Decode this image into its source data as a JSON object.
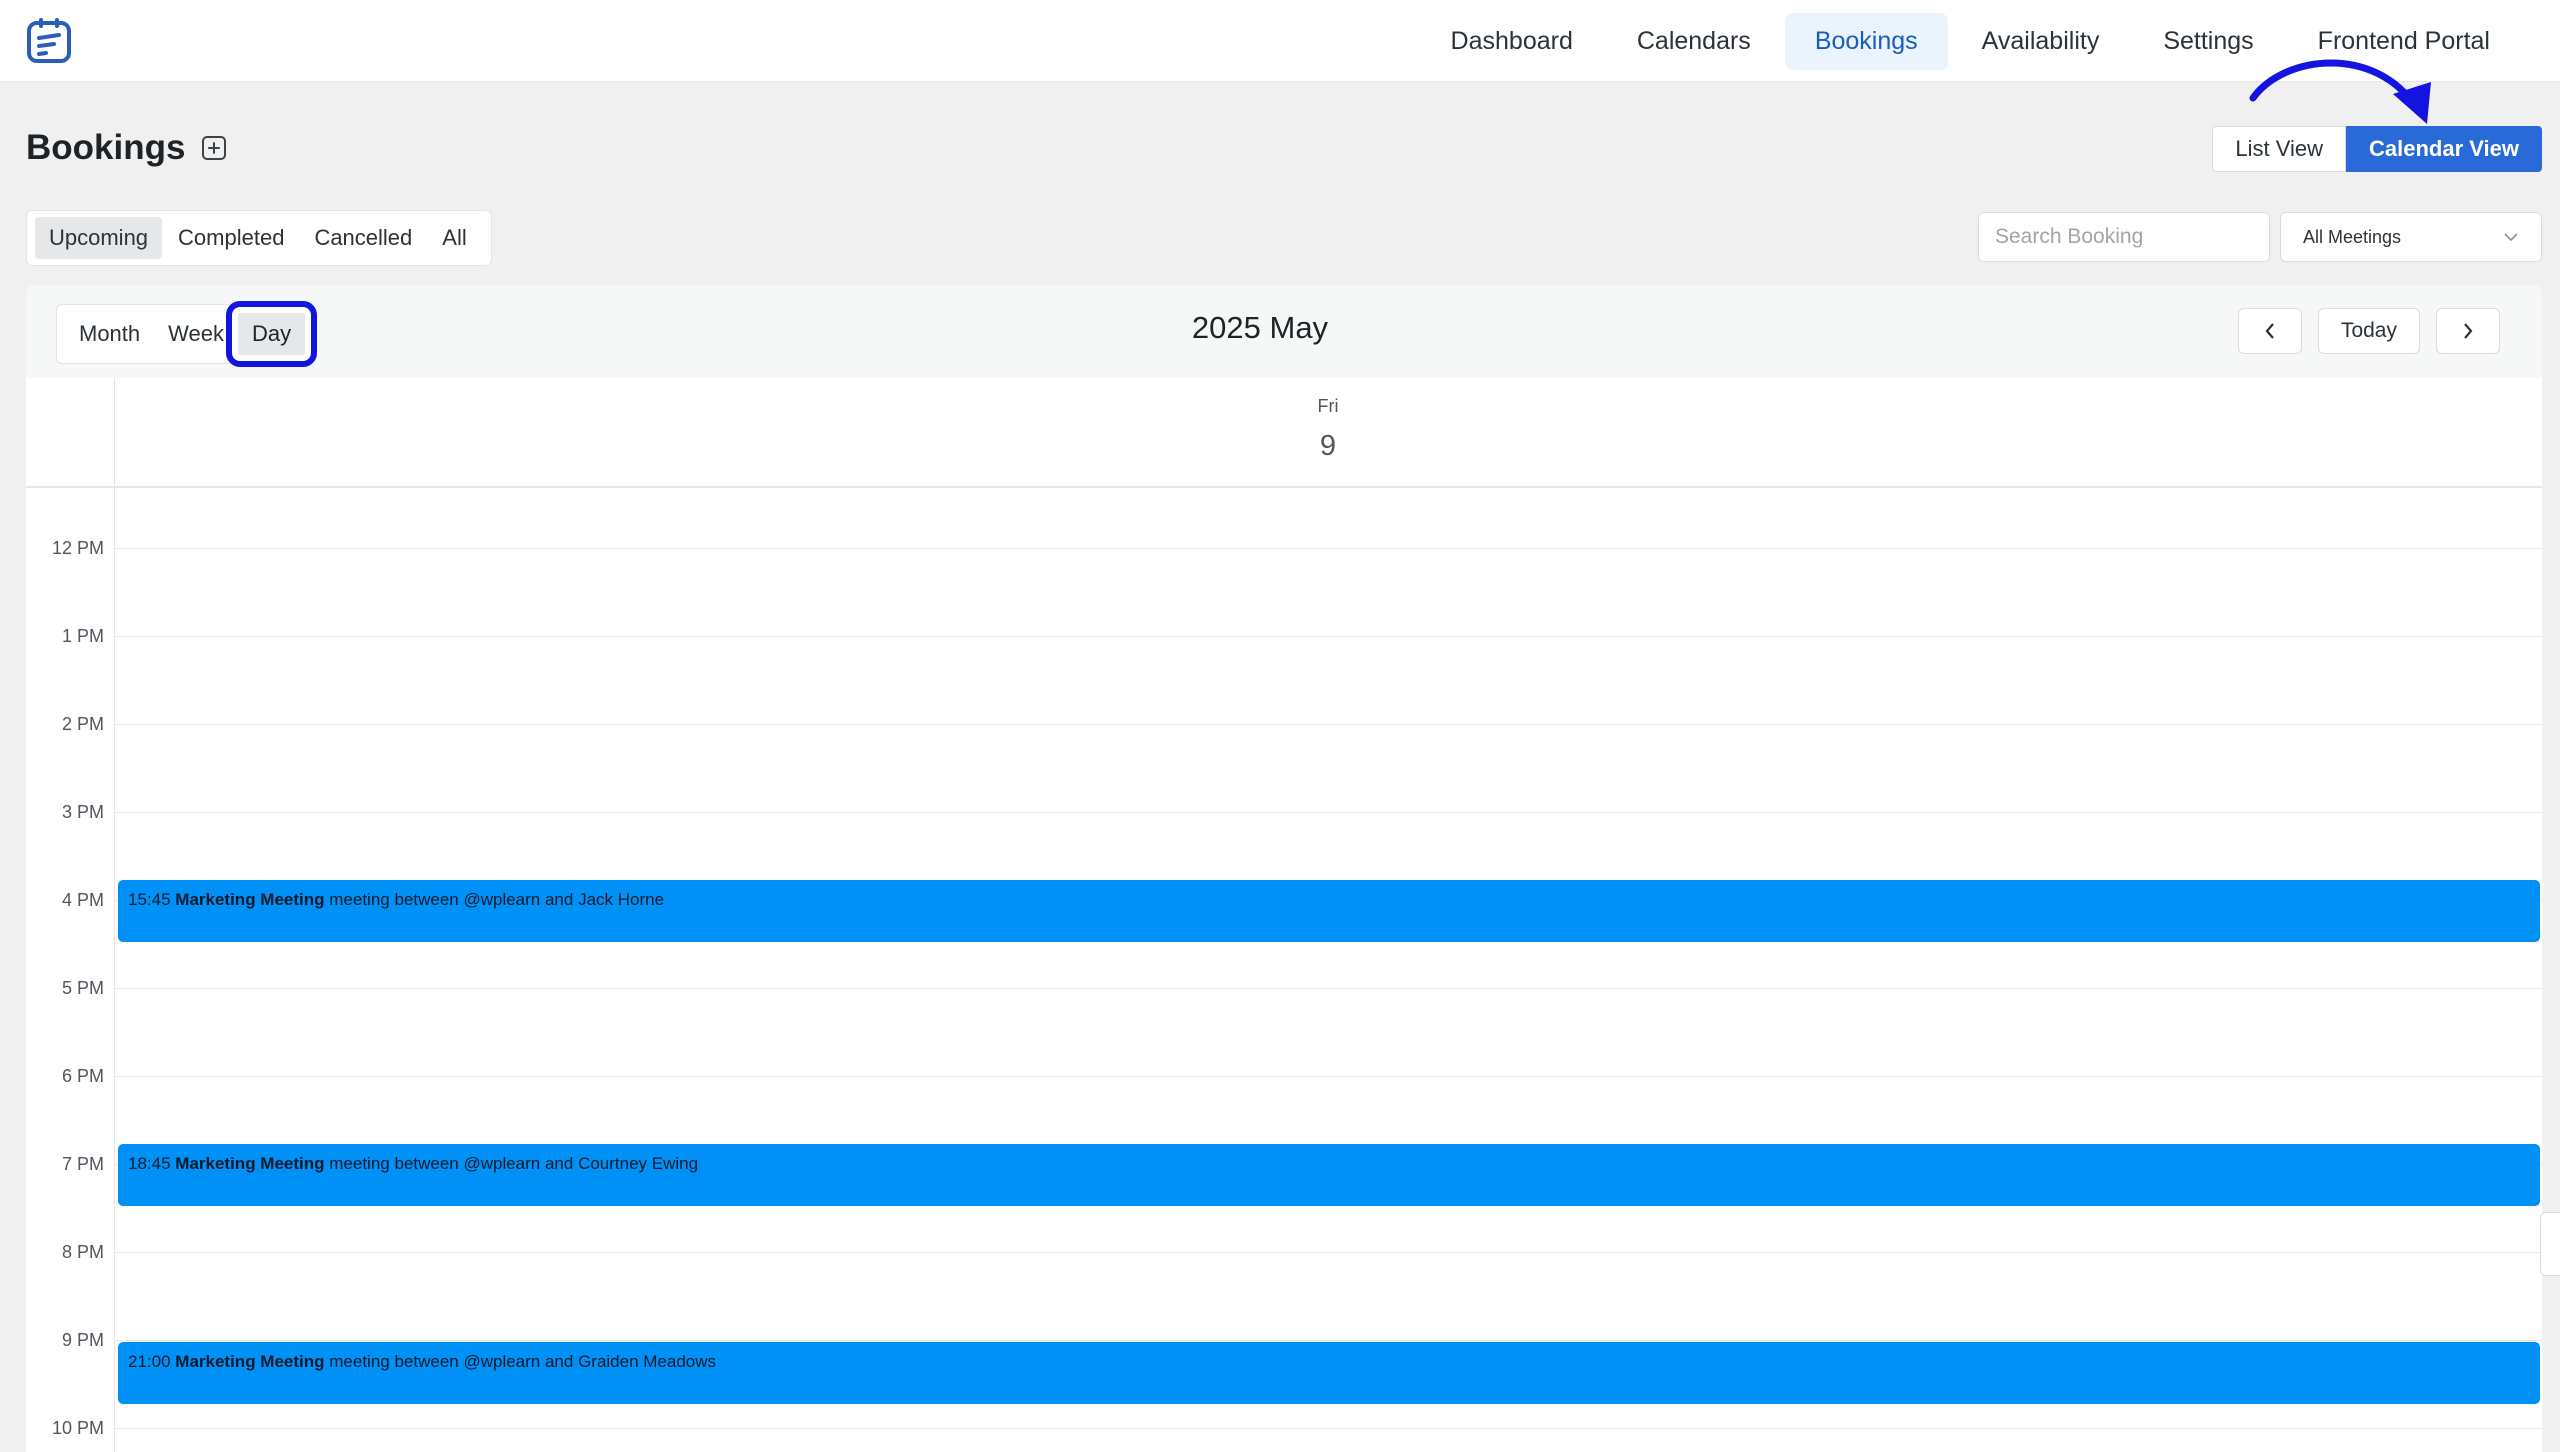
{
  "nav": {
    "items": [
      {
        "label": "Dashboard",
        "active": false
      },
      {
        "label": "Calendars",
        "active": false
      },
      {
        "label": "Bookings",
        "active": true
      },
      {
        "label": "Availability",
        "active": false
      },
      {
        "label": "Settings",
        "active": false
      },
      {
        "label": "Frontend Portal",
        "active": false
      }
    ]
  },
  "page": {
    "title": "Bookings",
    "add_icon": "plus-square-icon"
  },
  "view_toggle": {
    "list_label": "List View",
    "calendar_label": "Calendar View",
    "selected": "Calendar View"
  },
  "status_tabs": {
    "items": [
      "Upcoming",
      "Completed",
      "Cancelled",
      "All"
    ],
    "selected": "Upcoming"
  },
  "search": {
    "placeholder": "Search Booking",
    "value": ""
  },
  "meeting_filter": {
    "selected": "All Meetings"
  },
  "calendar": {
    "modes": [
      "Month",
      "Week",
      "Day"
    ],
    "selected_mode": "Day",
    "title": "2025 May",
    "today_label": "Today",
    "day_of_week": "Fri",
    "day_number": "9",
    "hour_labels": [
      "12 PM",
      "1 PM",
      "2 PM",
      "3 PM",
      "4 PM",
      "5 PM",
      "6 PM",
      "7 PM",
      "8 PM",
      "9 PM",
      "10 PM"
    ],
    "events": [
      {
        "time": "15:45",
        "title": "Marketing Meeting",
        "desc": "meeting between @wplearn and Jack Horne"
      },
      {
        "time": "18:45",
        "title": "Marketing Meeting",
        "desc": "meeting between @wplearn and Courtney Ewing"
      },
      {
        "time": "21:00",
        "title": "Marketing Meeting",
        "desc": "meeting between @wplearn and Graiden Meadows"
      }
    ]
  },
  "colors": {
    "primary": "#2a6ad8",
    "event": "#0091f7",
    "annotation": "#1414e0"
  }
}
